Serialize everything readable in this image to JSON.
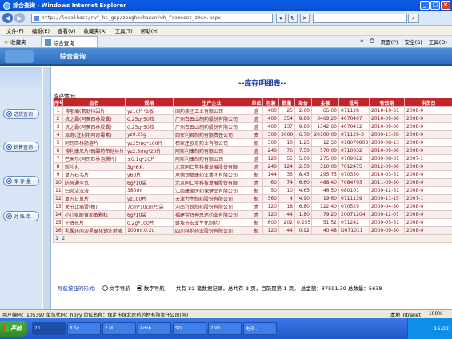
{
  "window": {
    "title": "综合查询 - Windows Internet Explorer"
  },
  "address": {
    "url": "http://localhost/rwf_hs_gsp/zonghechaxun/wh_frameset_zhcx.aspx"
  },
  "menu": [
    "文件(F)",
    "编辑(E)",
    "查看(V)",
    "收藏夹(A)",
    "工具(T)",
    "帮助(H)"
  ],
  "favbar": {
    "favorites": "收藏夹",
    "tab": "综合查询",
    "tools": [
      "页面(P)",
      "安全(S)",
      "工具(O)"
    ]
  },
  "app": {
    "title": "综合查询"
  },
  "sidebar": [
    {
      "label": "进货查询"
    },
    {
      "label": "销售查询"
    },
    {
      "label": "库 存 量"
    },
    {
      "label": "对 账 单"
    }
  ],
  "report": {
    "title": "--库存明细表--",
    "subtitle": "库存情况:",
    "columns": [
      "序号",
      "品名",
      "规格",
      "生产企业",
      "单位",
      "包装",
      "数量",
      "单价",
      "金额",
      "批号",
      "有效期",
      "供货日"
    ],
    "rows": [
      [
        "1",
        "博那痛(氨酚待因片)",
        "yz10片*2板",
        "国药集团工业有限公司",
        "盒",
        "400",
        "25",
        "2.60",
        "65.00",
        "071128",
        "2010-10-31",
        "2008-0"
      ],
      [
        "2",
        "抗之霸(阿莫西林胶囊)",
        "0.25g*50粒",
        "广州白云山制药股份有限公司",
        "盒",
        "400",
        "354",
        "9.80",
        "3469.20",
        "4070407",
        "2010-09-30",
        "2008-0"
      ],
      [
        "3",
        "抗之霸(阿莫西林胶囊)",
        "0.25g*50粒",
        "广州白云山制药股份有限公司",
        "盒",
        "400",
        "137",
        "9.80",
        "1342.60",
        "4070412",
        "2010-09-30",
        "2008-0"
      ],
      [
        "4",
        "派奇(注射用阿奇霉素)",
        "yz0.25g",
        "西安利君制药有限责任公司",
        "支",
        "300",
        "3000",
        "6.70",
        "20100.00",
        "071129-3",
        "2009-11-28",
        "2008-0"
      ],
      [
        "5",
        "阿司匹林肠溶片",
        "yz25mg*100片",
        "石家庄欧意药业有限公司",
        "瓶",
        "300",
        "10",
        "1.25",
        "12.50",
        "018070803",
        "2009-08-13",
        "2008-0"
      ],
      [
        "6",
        "博利康尼片(硫酸特布他林片)",
        "yz2.5mg*20片",
        "阿斯利康制药有限公司",
        "盒",
        "240",
        "76",
        "7.50",
        "570.00",
        "0710032",
        "2010-09-30",
        "2008-0"
      ],
      [
        "7",
        "巴米尔(阿司匹林泡腾片)",
        "±0.1g*20片",
        "阿斯利康制药有限公司",
        "盒",
        "120",
        "55",
        "5.00",
        "275.00",
        "0709022",
        "2009-08-31",
        "2007-1"
      ],
      [
        "8",
        "新叶丸",
        "3g*6丸",
        "北京同仁堂科技发展股份有限",
        "盒",
        "240",
        "124",
        "2.50",
        "310.00",
        "7012475",
        "2012-09-30",
        "2008-0"
      ],
      [
        "9",
        "复方石韦片",
        "y60片",
        "承德颈复康药业集团有限公司",
        "瓶",
        "144",
        "35",
        "8.45",
        "295.75",
        "070330",
        "2010-03-31",
        "2008-0"
      ],
      [
        "10",
        "防风通圣丸",
        "6g*10袋",
        "北京同仁堂科技发展股份有限",
        "盒",
        "60",
        "74",
        "6.60",
        "488.40",
        "7084793",
        "2011-09-30",
        "2008-0"
      ],
      [
        "11",
        "妇炎洁洗液",
        "380ml",
        "江西康美医药保健品有限公司",
        "瓶",
        "50",
        "10",
        "4.65",
        "46.50",
        "080101",
        "2009-12-31",
        "2008-0"
      ],
      [
        "12",
        "复方甘草片",
        "yz100片",
        "天津力生制药股份有限公司",
        "瓶",
        "360",
        "4",
        "4.90",
        "19.60",
        "0711139",
        "2009-11-15",
        "2007-1"
      ],
      [
        "13",
        "关节止痛膏(橡)",
        "7cm*10cm*5袋",
        "河南羚锐制药股份有限公司",
        "盒",
        "120",
        "18",
        "6.80",
        "122.40",
        "070529",
        "2009-04-30",
        "2008-0"
      ],
      [
        "14",
        "小儿氨酚黄那敏颗粒",
        "6g*10袋",
        "福建金辉神思达药业有限公司",
        "盒",
        "120",
        "44",
        "1.80",
        "79.20",
        "20071204",
        "2009-12-07",
        "2008-0"
      ],
      [
        "15",
        "千醇母片",
        "0.2g*100片",
        "蚌埠市宏业生化制药厂",
        "瓶",
        "600",
        "202",
        "0.255",
        "51.52",
        "071242",
        "2009-05-31",
        "2008-0"
      ],
      [
        "16",
        "乳酸环丙沙星氯化钠注射液",
        "100ml:0.2g",
        "四川科伦药业股份有限公司",
        "瓶",
        "120",
        "44",
        "0.92",
        "40.48",
        "D071011",
        "2009-09-30",
        "2008-0"
      ]
    ],
    "pager": [
      "1",
      "2"
    ]
  },
  "footer": {
    "nav_label": "导航按钮的形式:",
    "option_text": "文字导航",
    "option_number": "数字导航",
    "stat_prefix": "共有",
    "records": "32",
    "stat_mid": "笔数据记录，总共有",
    "pages": "2",
    "stat_mid2": "页，目前是第",
    "current_page": "1",
    "stat_tail": "页。 总金额：37591.39  总数量：5638"
  },
  "status": {
    "left": "用户编码：105397 单位代码：hbyy 单位名称：保定市保北医药药材有限责任公司(何)",
    "zone": "本地 Intranet",
    "zoom": "100%"
  },
  "taskbar": {
    "start": "开始",
    "tasks": [
      "2 I...",
      "3 Sy...",
      "2 M...",
      "Adob...",
      "SQL...",
      "2 Wi...",
      "电子..."
    ],
    "clock": "16:22"
  }
}
